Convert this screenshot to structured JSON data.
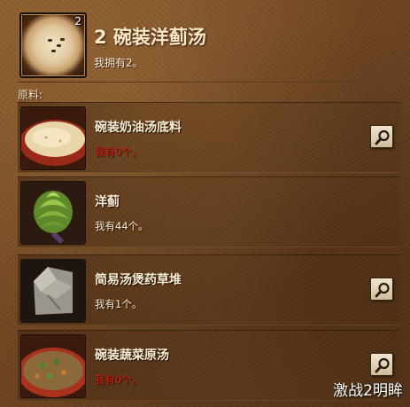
{
  "header": {
    "title": "2 碗装洋蓟汤",
    "subtitle": "我拥有2。",
    "icon_count": "2",
    "icon": "bowl-of-artichoke-soup"
  },
  "section_label": "原料:",
  "ingredients": [
    {
      "name": "碗装奶油汤底料",
      "have": "我有0个。",
      "status": "missing",
      "icon": "cream-soup-bowl",
      "has_search": true
    },
    {
      "name": "洋蓟",
      "have": "我有44个。",
      "status": "ok",
      "icon": "artichoke",
      "has_search": false
    },
    {
      "name": "简易汤煲药草堆",
      "have": "我有1个。",
      "status": "ok",
      "icon": "herb-sack",
      "has_search": true
    },
    {
      "name": "碗装蔬菜原汤",
      "have": "我有0个。",
      "status": "missing",
      "icon": "vegetable-broth-bowl",
      "has_search": true
    }
  ],
  "colors": {
    "missing": "#e01a10",
    "ok": "#f7ecd4",
    "panel": "#6e4522"
  },
  "watermark": "激战2明眸"
}
